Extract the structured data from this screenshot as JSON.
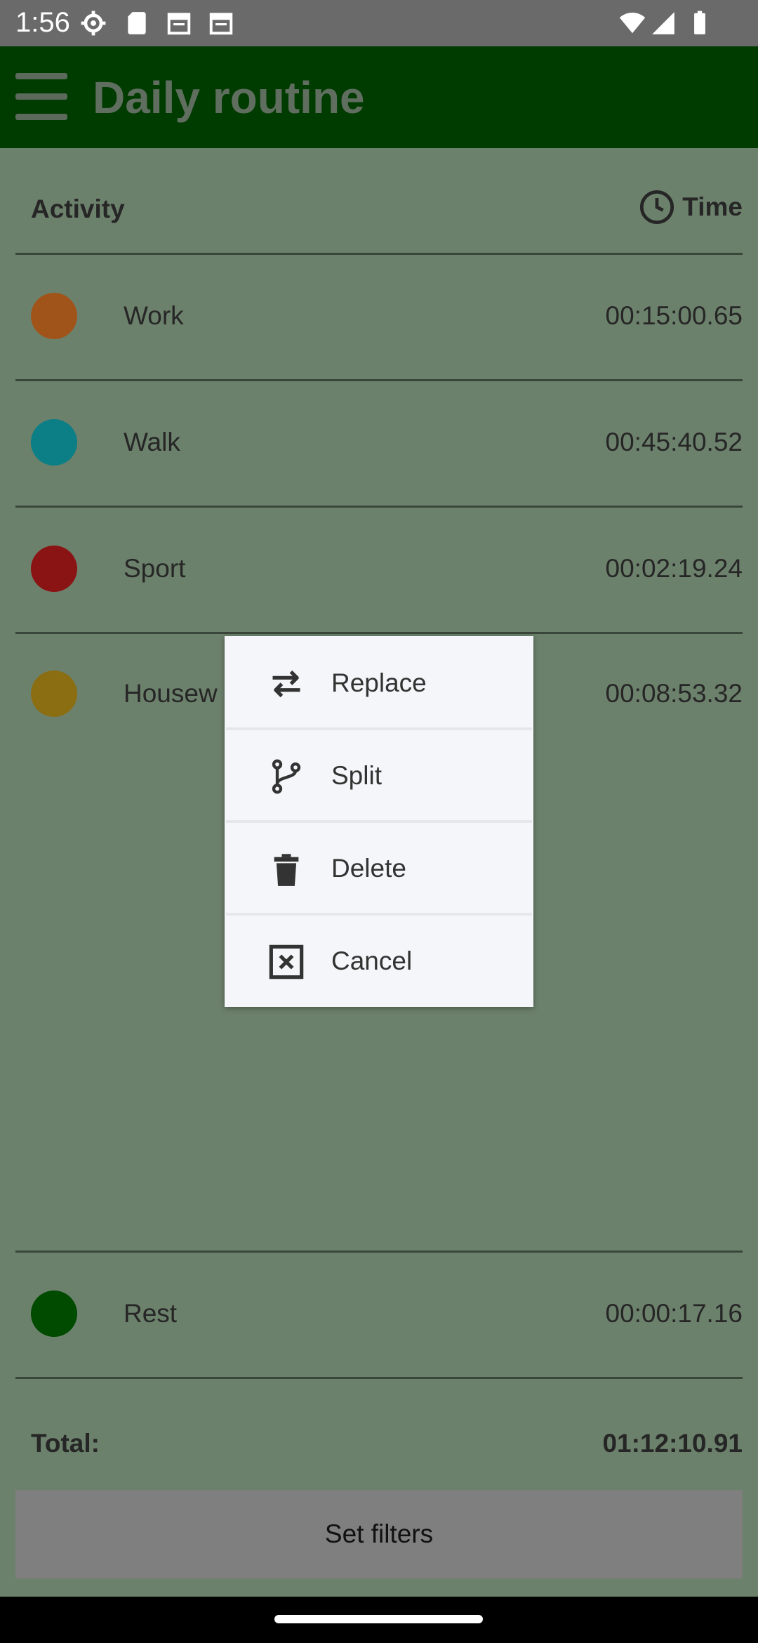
{
  "status_bar": {
    "time": "1:56"
  },
  "app_bar": {
    "title": "Daily routine"
  },
  "table": {
    "header": {
      "activity": "Activity",
      "time": "Time"
    },
    "rows": [
      {
        "name": "Work",
        "duration": "00:15:00.65",
        "color": "#a0541a"
      },
      {
        "name": "Walk",
        "duration": "00:45:40.52",
        "color": "#0b7e86"
      },
      {
        "name": "Sport",
        "duration": "00:02:19.24",
        "color": "#8a1414"
      },
      {
        "name": "Housew",
        "duration": "00:08:53.32",
        "color": "#8b6d12"
      }
    ],
    "rest_row": {
      "name": "Rest",
      "duration": "00:00:17.16",
      "color": "#004b00"
    },
    "total": {
      "label": "Total:",
      "value": "01:12:10.91"
    }
  },
  "filters_button": {
    "label": "Set filters"
  },
  "context_menu": {
    "items": [
      {
        "label": "Replace",
        "icon": "swap-arrows-icon"
      },
      {
        "label": "Split",
        "icon": "branch-split-icon"
      },
      {
        "label": "Delete",
        "icon": "trash-icon"
      },
      {
        "label": "Cancel",
        "icon": "close-box-icon"
      }
    ]
  }
}
